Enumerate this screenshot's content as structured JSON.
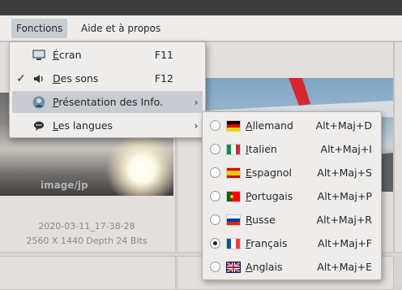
{
  "menubar": {
    "items": [
      {
        "label": "Fonctions",
        "active": true
      },
      {
        "label": "Aide et à propos",
        "active": false
      }
    ]
  },
  "functions_menu": {
    "items": [
      {
        "label_first": "É",
        "label_rest": "cran",
        "shortcut": "F11",
        "icon": "monitor-icon",
        "checked": false,
        "submenu": false
      },
      {
        "label_first": "D",
        "label_rest": "es sons",
        "shortcut": "F12",
        "icon": "speaker-icon",
        "checked": true,
        "submenu": false
      },
      {
        "label_first": "P",
        "label_rest": "résentation des Info.",
        "shortcut": "",
        "icon": "user-avatar-icon",
        "checked": false,
        "submenu": true
      },
      {
        "label_first": "L",
        "label_rest": "es langues",
        "shortcut": "",
        "icon": "speech-bubble-icon",
        "checked": false,
        "submenu": true
      }
    ]
  },
  "languages_menu": {
    "items": [
      {
        "label_first": "A",
        "label_rest": "llemand",
        "shortcut": "Alt+Maj+D",
        "flag": "de",
        "selected": false
      },
      {
        "label_first": "I",
        "label_rest": "talien",
        "shortcut": "Alt+Maj+I",
        "flag": "it",
        "selected": false
      },
      {
        "label_first": "E",
        "label_rest": "spagnol",
        "shortcut": "Alt+Maj+S",
        "flag": "es",
        "selected": false
      },
      {
        "label_first": "P",
        "label_rest": "ortugais",
        "shortcut": "Alt+Maj+P",
        "flag": "pt",
        "selected": false
      },
      {
        "label_first": "R",
        "label_rest": "usse",
        "shortcut": "Alt+Maj+R",
        "flag": "ru",
        "selected": false
      },
      {
        "label_first": "F",
        "label_rest": "rançais",
        "shortcut": "Alt+Maj+F",
        "flag": "fr",
        "selected": true
      },
      {
        "label_first": "A",
        "label_rest": "nglais",
        "shortcut": "Alt+Maj+E",
        "flag": "gb",
        "selected": false
      }
    ]
  },
  "background": {
    "thumbnail_caption_date": "2020-03-11_17-38-28",
    "thumbnail_caption_info": "2560 X 1440 Depth 24 Bits",
    "watermark": "image/jp"
  },
  "colors": {
    "menu_bg": "#efedeb",
    "highlight": "#c8ccd1",
    "titlebar": "#3c3c3c"
  }
}
